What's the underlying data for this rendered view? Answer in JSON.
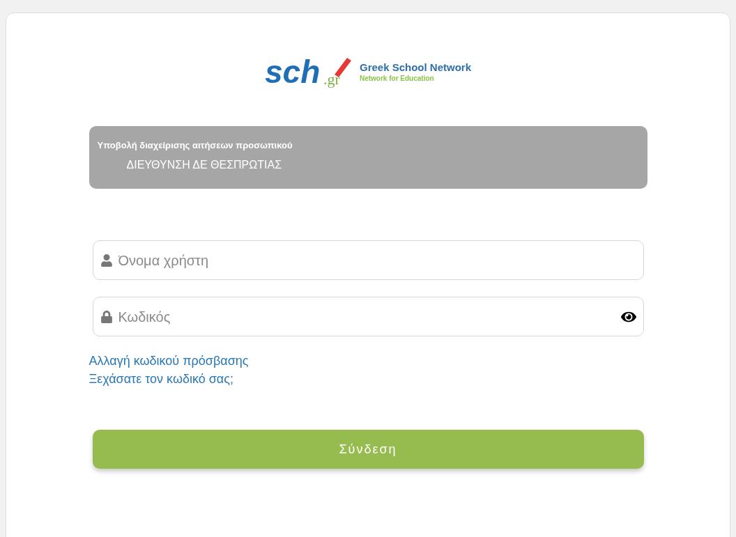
{
  "logo": {
    "mark": "sch",
    "domain": ".gr",
    "title": "Greek School Network",
    "subtitle": "Network for Education"
  },
  "banner": {
    "title": "Υποβολή διαχείρισης αιτήσεων προσωπικού",
    "subtitle": "ΔΙΕΥΘΥΝΣΗ ΔΕ ΘΕΣΠΡΩΤΙΑΣ"
  },
  "fields": [
    {
      "kind": "user",
      "placeholder": "Όνομα χρήστη"
    },
    {
      "kind": "password",
      "placeholder": "Κωδικός"
    }
  ],
  "links": [
    "Αλλαγή κωδικού πρόσβασης",
    "Ξεχάσατε τον κωδικό σας;"
  ],
  "submit": "Σύνδεση"
}
